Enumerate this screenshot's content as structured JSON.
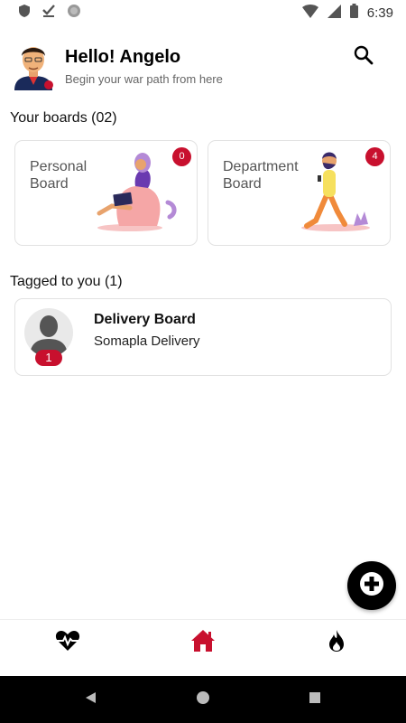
{
  "status_bar": {
    "time": "6:39",
    "left_icons": [
      "shield-icon",
      "download-done-icon",
      "sync-icon"
    ],
    "right_icons": [
      "wifi-icon",
      "signal-icon",
      "battery-icon"
    ]
  },
  "header": {
    "greeting": "Hello! Angelo",
    "subtitle": "Begin your war path from here"
  },
  "boards": {
    "title": "Your boards (02)",
    "items": [
      {
        "name": "Personal Board",
        "count": "0"
      },
      {
        "name": "Department Board",
        "count": "4"
      }
    ]
  },
  "tagged": {
    "title": "Tagged to you (1)",
    "items": [
      {
        "title": "Delivery Board",
        "subtitle": "Somapla Delivery",
        "count": "1"
      }
    ]
  },
  "bottom_nav": {
    "items": [
      "heartbeat-icon",
      "home-icon",
      "fire-icon"
    ],
    "active": "home-icon"
  },
  "colors": {
    "accent": "#c8102e",
    "fab": "#000000"
  }
}
